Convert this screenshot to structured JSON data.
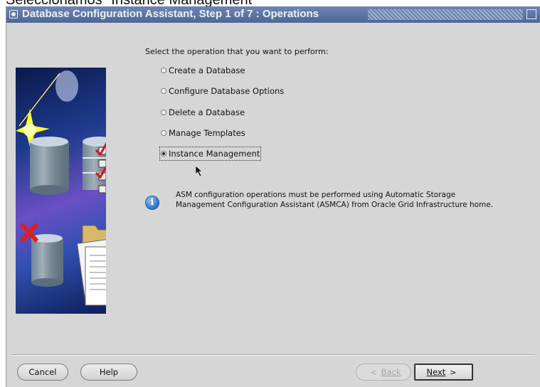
{
  "caption": "Seleccionamos \"Instance Management\"",
  "window": {
    "title": "Database Configuration Assistant, Step 1 of 7 : Operations"
  },
  "prompt": "Select the operation that you want to perform:",
  "operations": [
    {
      "label": "Create a Database",
      "selected": false
    },
    {
      "label": "Configure Database Options",
      "selected": false
    },
    {
      "label": "Delete a Database",
      "selected": false
    },
    {
      "label": "Manage Templates",
      "selected": false
    },
    {
      "label": "Instance Management",
      "selected": true
    }
  ],
  "info": {
    "line1": "ASM configuration operations must be performed using Automatic Storage",
    "line2": "Management Configuration Assistant (ASMCA) from Oracle Grid Infrastructure home."
  },
  "buttons": {
    "cancel": "Cancel",
    "help": "Help",
    "back": "Back",
    "back_arrow": "<",
    "next": "Next",
    "next_arrow": ">"
  },
  "colors": {
    "titlebar": "#5a72a4",
    "window_bg": "#d6d6d6"
  }
}
